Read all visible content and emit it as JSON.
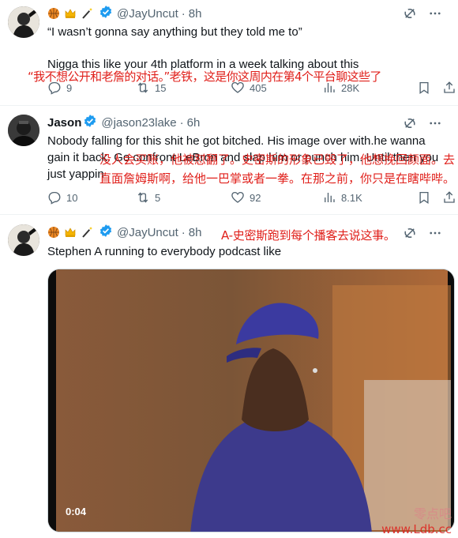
{
  "tweets": [
    {
      "handle": "@JayUncut",
      "sep": "·",
      "time": "8h",
      "emojis": [
        "basketball-emoji",
        "crown-emoji",
        "magic-wand-emoji"
      ],
      "text_line1": "“I wasn’t gonna say anything but they told me to”",
      "text_line2": "Nigga this like your 4th platform in a week talking about this",
      "overlay": "“我不想公开和老詹的对话。”老铁，这是你这周内在第4个平台聊这些了",
      "stats": {
        "replies": "9",
        "reposts": "15",
        "likes": "405",
        "views": "28K"
      }
    },
    {
      "name": "Jason",
      "handle": "@jason23lake",
      "sep": "·",
      "time": "6h",
      "text": "Nobody falling for this shit he got bitched. His image over with.he wanna gain it back. Go confront LeBron and slap him or punch him. Until then you just yappin",
      "overlay": "没人会买账，他被怼翻了。史密斯的形象已毁了，他想挽回颜面。去直面詹姆斯啊，给他一巴掌或者一拳。在那之前，你只是在瞎哔哔。",
      "stats": {
        "replies": "10",
        "reposts": "5",
        "likes": "92",
        "views": "8.1K"
      }
    },
    {
      "handle": "@JayUncut",
      "sep": "·",
      "time": "8h",
      "emojis": [
        "basketball-emoji",
        "crown-emoji",
        "magic-wand-emoji"
      ],
      "text": "Stephen A running to everybody podcast like",
      "overlay": "A-史密斯跑到每个播客去说这事。",
      "video": {
        "timestamp": "0:04"
      }
    }
  ],
  "watermark": {
    "line1": "零点吧",
    "line2": "www.Ldb.cc"
  },
  "colors": {
    "text": "#0f1419",
    "secondary": "#536471",
    "verified": "#1d9bf0",
    "overlay": "#e0201b"
  }
}
